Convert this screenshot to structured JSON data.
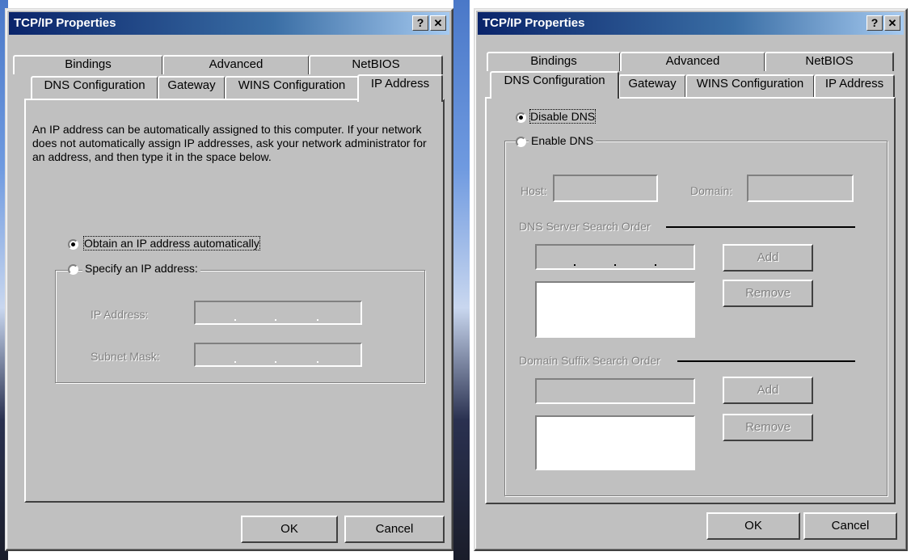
{
  "left": {
    "title": "TCP/IP Properties",
    "help_glyph": "?",
    "close_glyph": "✕",
    "tabs_row1": [
      "Bindings",
      "Advanced",
      "NetBIOS"
    ],
    "tabs_row2": [
      "DNS Configuration",
      "Gateway",
      "WINS Configuration",
      "IP Address"
    ],
    "active_tab": "IP Address",
    "description": "An IP address can be automatically assigned to this computer. If your network does not automatically assign IP addresses, ask your network administrator for an address, and then type it in the space below.",
    "obtain_auto_label": "Obtain an IP address automatically",
    "specify_label": "Specify an IP address:",
    "selected_option": "obtain",
    "ip_address_label": "IP Address:",
    "subnet_mask_label": "Subnet Mask:",
    "ip_address_value": "",
    "subnet_mask_value": "",
    "ok_label": "OK",
    "cancel_label": "Cancel"
  },
  "right": {
    "title": "TCP/IP Properties",
    "help_glyph": "?",
    "close_glyph": "✕",
    "tabs_row1": [
      "Bindings",
      "Advanced",
      "NetBIOS"
    ],
    "tabs_row2": [
      "DNS Configuration",
      "Gateway",
      "WINS Configuration",
      "IP Address"
    ],
    "active_tab": "DNS Configuration",
    "disable_dns_label": "Disable DNS",
    "enable_dns_label": "Enable DNS",
    "selected_option": "disable",
    "host_label": "Host:",
    "domain_label": "Domain:",
    "host_value": "",
    "domain_value": "",
    "dns_server_order_label": "DNS Server Search Order",
    "dns_add_label": "Add",
    "dns_remove_label": "Remove",
    "domain_suffix_label": "Domain Suffix Search Order",
    "suffix_add_label": "Add",
    "suffix_remove_label": "Remove",
    "ok_label": "OK",
    "cancel_label": "Cancel"
  },
  "colors": {
    "dialog_face": "#c0c0c0",
    "title_start": "#0a246a",
    "title_end": "#a6caf0",
    "disabled_text": "#808080"
  }
}
